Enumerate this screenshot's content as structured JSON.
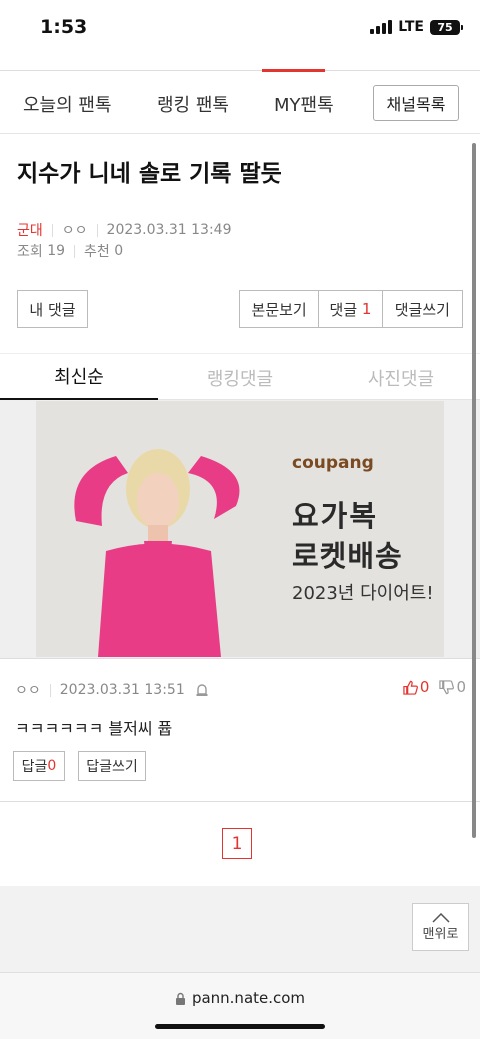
{
  "status": {
    "time": "1:53",
    "network": "LTE",
    "battery": "75"
  },
  "nav": {
    "items": [
      "오늘의 팬톡",
      "랭킹 팬톡",
      "MY팬톡"
    ],
    "channel_button": "채널목록"
  },
  "post": {
    "title": "지수가 니네 솔로 기록 딸듯",
    "category": "군대",
    "author": "ㅇㅇ",
    "datetime": "2023.03.31 13:49",
    "views_label": "조회",
    "views": "19",
    "recommend_label": "추천",
    "recommend": "0"
  },
  "actions": {
    "my_comments": "내 댓글",
    "view_post": "본문보기",
    "comments_label": "댓글",
    "comments_count": "1",
    "write_comment": "댓글쓰기"
  },
  "tabs": [
    "최신순",
    "랭킹댓글",
    "사진댓글"
  ],
  "ad": {
    "brand": "coupang",
    "line1": "요가복",
    "line2": "로켓배송",
    "line3": "2023년 다이어트!"
  },
  "comment": {
    "author": "ㅇㅇ",
    "datetime": "2023.03.31 13:51",
    "likes": "0",
    "dislikes": "0",
    "text": "ㅋㅋㅋㅋㅋㅋ 블저씨 퓹",
    "reply_label": "답글",
    "reply_count": "0",
    "write_reply": "답글쓰기"
  },
  "pagination": {
    "current": "1"
  },
  "top_button": "맨위로",
  "browser": {
    "url": "pann.nate.com"
  },
  "colors": {
    "accent": "#e3342f"
  }
}
